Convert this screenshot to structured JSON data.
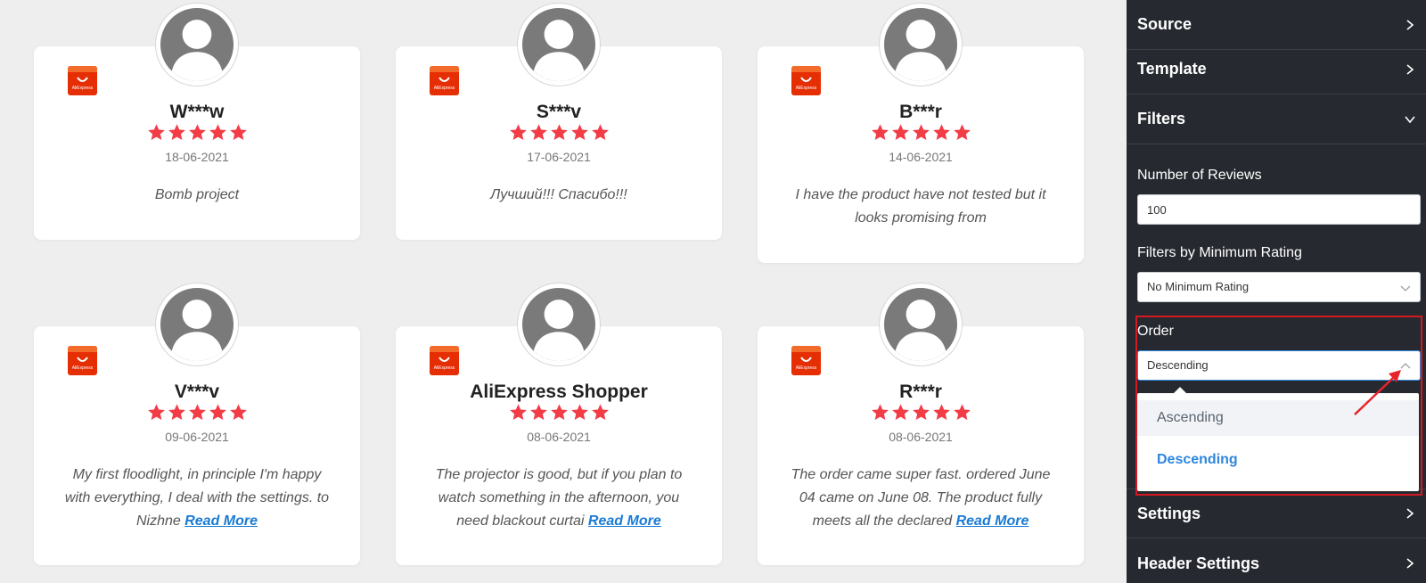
{
  "brand": {
    "name": "AliExpress"
  },
  "reviews": [
    {
      "reviewer": "W***w",
      "date": "18-06-2021",
      "text": "Bomb project",
      "read_more": "",
      "rating": 5
    },
    {
      "reviewer": "S***v",
      "date": "17-06-2021",
      "text": "Лучший!!! Спасибо!!!",
      "read_more": "",
      "rating": 5
    },
    {
      "reviewer": "B***r",
      "date": "14-06-2021",
      "text": "I have the product have not tested but it looks promising from",
      "read_more": "",
      "rating": 5
    },
    {
      "reviewer": "V***v",
      "date": "09-06-2021",
      "text": "My first floodlight, in principle I'm happy with everything, I deal with the settings. to Nizhne ",
      "read_more": "Read More",
      "rating": 5
    },
    {
      "reviewer": "AliExpress Shopper",
      "date": "08-06-2021",
      "text": "The projector is good, but if you plan to watch something in the afternoon, you need blackout curtai ",
      "read_more": "Read More",
      "rating": 5
    },
    {
      "reviewer": "R***r",
      "date": "08-06-2021",
      "text": "The order came super fast. ordered June 04 came on June 08. The product fully meets all the declared ",
      "read_more": "Read More",
      "rating": 5
    }
  ],
  "sidebar": {
    "sections": {
      "source": "Source",
      "template": "Template",
      "filters": "Filters",
      "settings": "Settings",
      "header_settings": "Header Settings"
    },
    "filters": {
      "number_of_reviews_label": "Number of Reviews",
      "number_of_reviews_value": "100",
      "min_rating_label": "Filters by Minimum Rating",
      "min_rating_value": "No Minimum Rating",
      "order_label": "Order",
      "order_value": "Descending",
      "order_options": [
        "Ascending",
        "Descending"
      ]
    }
  },
  "colors": {
    "star": "#f23c46",
    "brand_logo": "#e62e04",
    "link": "#1a7bd4",
    "sidebar_bg": "#262a30",
    "highlight": "#d41920",
    "selected_option": "#2e86de",
    "annotation_arrow": "#e8232b"
  },
  "icons": {
    "avatar": "user-silhouette-icon",
    "brand": "shopping-bag-icon",
    "star": "star-icon",
    "chevron_right": "chevron-right-icon",
    "chevron_down": "chevron-down-icon",
    "chevron_up": "chevron-up-icon"
  }
}
